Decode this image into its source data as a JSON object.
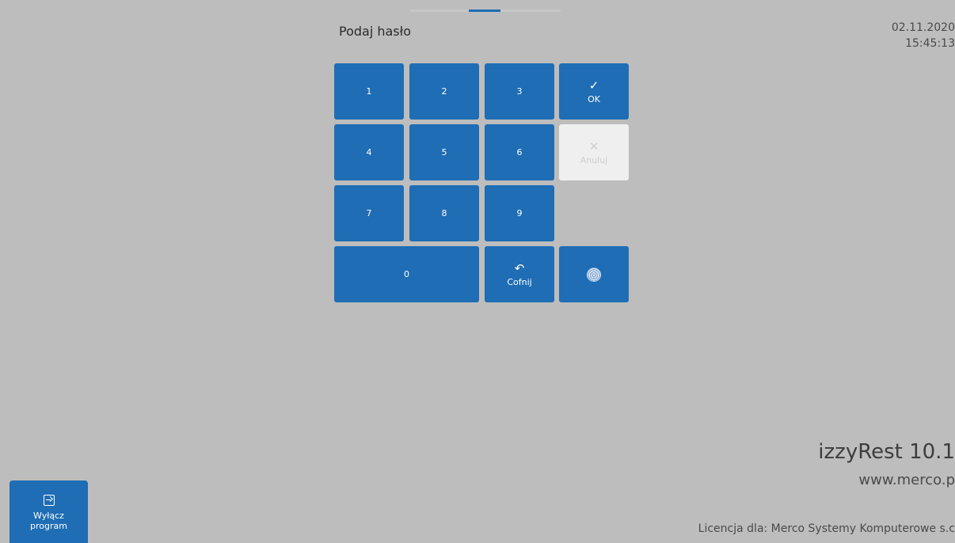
{
  "header": {
    "prompt": "Podaj hasło",
    "date": "02.11.2020",
    "time": "15:45:13"
  },
  "keypad": {
    "digits": {
      "k1": "1",
      "k2": "2",
      "k3": "3",
      "k4": "4",
      "k5": "5",
      "k6": "6",
      "k7": "7",
      "k8": "8",
      "k9": "9",
      "k0": "0"
    },
    "ok": {
      "label": "OK",
      "icon": "check-icon"
    },
    "cancel": {
      "label": "Anuluj",
      "icon": "close-icon",
      "enabled": false
    },
    "back": {
      "label": "Cofnij",
      "icon": "undo-icon"
    },
    "fingerprint": {
      "icon": "fingerprint-icon"
    }
  },
  "footer": {
    "product": "izzyRest 10.1",
    "website": "www.merco.p",
    "license": "Licencja dla: Merco Systemy Komputerowe s.c"
  },
  "exit_button": {
    "line1": "Wyłącz",
    "line2": "program",
    "icon": "exit-icon"
  },
  "colors": {
    "background": "#bdbdbd",
    "key": "#1f6db4",
    "key_disabled": "#efefef"
  }
}
